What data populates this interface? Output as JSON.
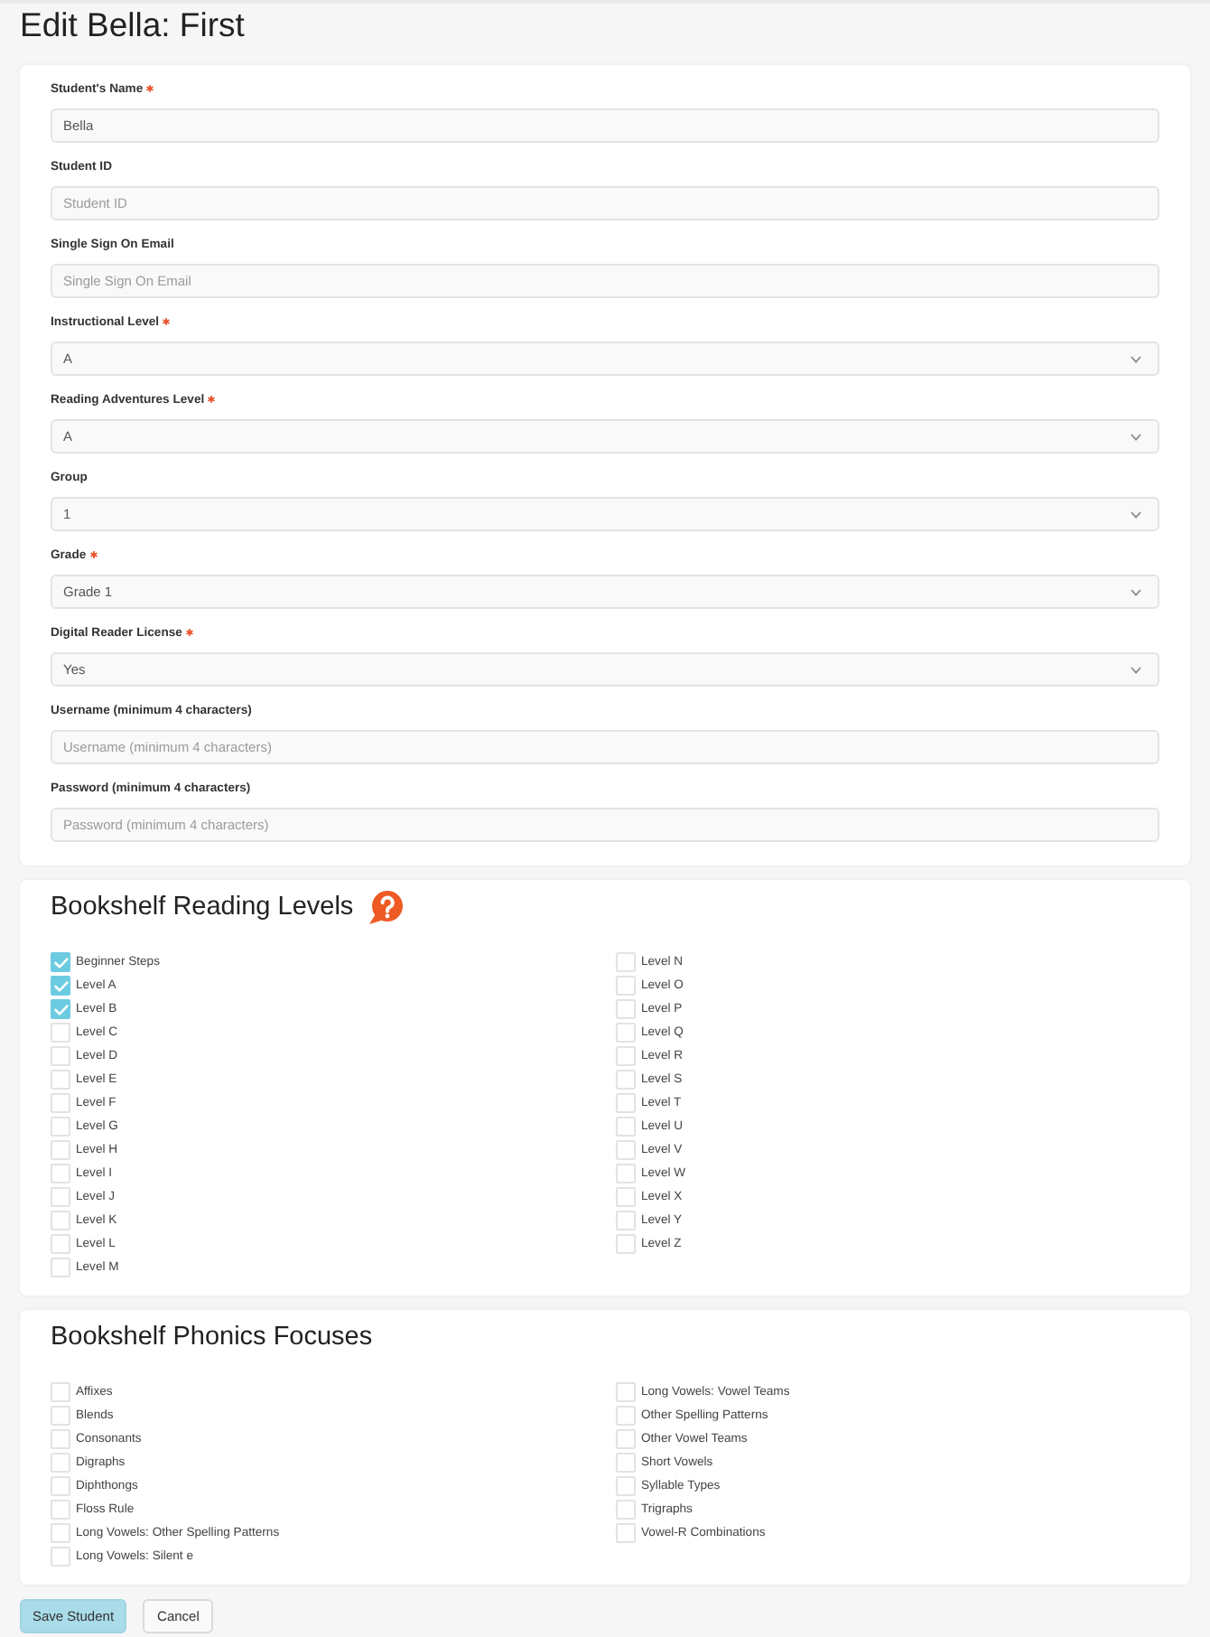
{
  "page": {
    "title": "Edit Bella: First"
  },
  "student_form": {
    "fields": [
      {
        "label": "Student's Name",
        "required": true,
        "kind": "text",
        "value": "Bella"
      },
      {
        "label": "Student ID",
        "required": false,
        "kind": "text",
        "placeholder": "Student ID"
      },
      {
        "label": "Single Sign On Email",
        "required": false,
        "kind": "text",
        "placeholder": "Single Sign On Email"
      },
      {
        "label": "Instructional Level",
        "required": true,
        "kind": "select",
        "value": "A"
      },
      {
        "label": "Reading Adventures Level",
        "required": true,
        "kind": "select",
        "value": "A"
      },
      {
        "label": "Group",
        "required": false,
        "kind": "select",
        "value": "1"
      },
      {
        "label": "Grade",
        "required": true,
        "kind": "select",
        "value": "Grade 1"
      },
      {
        "label": "Digital Reader License",
        "required": true,
        "kind": "select",
        "value": "Yes"
      },
      {
        "label": "Username (minimum 4 characters)",
        "required": false,
        "kind": "text",
        "placeholder": "Username (minimum 4 characters)"
      },
      {
        "label": "Password (minimum 4 characters)",
        "required": false,
        "kind": "text",
        "placeholder": "Password (minimum 4 characters)"
      }
    ]
  },
  "reading_levels": {
    "title": "Bookshelf Reading Levels",
    "help": true,
    "items": [
      {
        "label": "Beginner Steps",
        "checked": true
      },
      {
        "label": "Level A",
        "checked": true
      },
      {
        "label": "Level B",
        "checked": true
      },
      {
        "label": "Level C",
        "checked": false
      },
      {
        "label": "Level D",
        "checked": false
      },
      {
        "label": "Level E",
        "checked": false
      },
      {
        "label": "Level F",
        "checked": false
      },
      {
        "label": "Level G",
        "checked": false
      },
      {
        "label": "Level H",
        "checked": false
      },
      {
        "label": "Level I",
        "checked": false
      },
      {
        "label": "Level J",
        "checked": false
      },
      {
        "label": "Level K",
        "checked": false
      },
      {
        "label": "Level L",
        "checked": false
      },
      {
        "label": "Level M",
        "checked": false
      },
      {
        "label": "Level N",
        "checked": false
      },
      {
        "label": "Level O",
        "checked": false
      },
      {
        "label": "Level P",
        "checked": false
      },
      {
        "label": "Level Q",
        "checked": false
      },
      {
        "label": "Level R",
        "checked": false
      },
      {
        "label": "Level S",
        "checked": false
      },
      {
        "label": "Level T",
        "checked": false
      },
      {
        "label": "Level U",
        "checked": false
      },
      {
        "label": "Level V",
        "checked": false
      },
      {
        "label": "Level W",
        "checked": false
      },
      {
        "label": "Level X",
        "checked": false
      },
      {
        "label": "Level Y",
        "checked": false
      },
      {
        "label": "Level Z",
        "checked": false
      }
    ]
  },
  "phonics_focuses": {
    "title": "Bookshelf Phonics Focuses",
    "items": [
      {
        "label": "Affixes",
        "checked": false
      },
      {
        "label": "Blends",
        "checked": false
      },
      {
        "label": "Consonants",
        "checked": false
      },
      {
        "label": "Digraphs",
        "checked": false
      },
      {
        "label": "Diphthongs",
        "checked": false
      },
      {
        "label": "Floss Rule",
        "checked": false
      },
      {
        "label": "Long Vowels: Other Spelling Patterns",
        "checked": false
      },
      {
        "label": "Long Vowels: Silent e",
        "checked": false
      },
      {
        "label": "Long Vowels: Vowel Teams",
        "checked": false
      },
      {
        "label": "Other Spelling Patterns",
        "checked": false
      },
      {
        "label": "Other Vowel Teams",
        "checked": false
      },
      {
        "label": "Short Vowels",
        "checked": false
      },
      {
        "label": "Syllable Types",
        "checked": false
      },
      {
        "label": "Trigraphs",
        "checked": false
      },
      {
        "label": "Vowel-R Combinations",
        "checked": false
      }
    ]
  },
  "buttons": [
    {
      "label": "Save Student",
      "kind": "primary"
    },
    {
      "label": "Cancel",
      "kind": "secondary"
    }
  ]
}
